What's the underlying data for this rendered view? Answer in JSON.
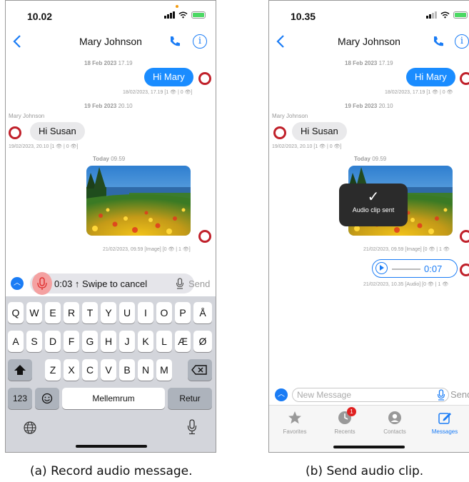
{
  "phone_a": {
    "status": {
      "time": "10.02"
    },
    "nav": {
      "title": "Mary Johnson"
    },
    "messages": {
      "date1": "18 Feb 2023",
      "date1_time": "17.19",
      "out1_text": "Hi Mary",
      "out1_meta": "18/02/2023, 17.19  [1 👁 | 0 👁]",
      "date2": "19 Feb 2023",
      "date2_time": "20.10",
      "in_sender": "Mary Johnson",
      "in1_text": "Hi Susan",
      "in1_meta": "19/02/2023, 20.10  [1 👁 | 0 👁]",
      "today": "Today",
      "today_time": "09.59",
      "img_meta": "21/02/2023, 09.59 [Image]  [0 👁 | 1 👁]"
    },
    "recorder": {
      "text": "0:03 ↑ Swipe to cancel",
      "send": "Send"
    },
    "keyboard": {
      "row1": [
        "Q",
        "W",
        "E",
        "R",
        "T",
        "Y",
        "U",
        "I",
        "O",
        "P",
        "Å"
      ],
      "row2": [
        "A",
        "S",
        "D",
        "F",
        "G",
        "H",
        "J",
        "K",
        "L",
        "Æ",
        "Ø"
      ],
      "row3": [
        "Z",
        "X",
        "C",
        "V",
        "B",
        "N",
        "M"
      ],
      "num_key": "123",
      "space": "Mellemrum",
      "return": "Retur"
    },
    "caption": "(a) Record audio message."
  },
  "phone_b": {
    "status": {
      "time": "10.35"
    },
    "nav": {
      "title": "Mary Johnson"
    },
    "messages": {
      "date1": "18 Feb 2023",
      "date1_time": "17.19",
      "out1_text": "Hi Mary",
      "out1_meta": "18/02/2023, 17.19  [1 👁 | 0 👁",
      "date2": "19 Feb 2023",
      "date2_time": "20.10",
      "in_sender": "Mary Johnson",
      "in1_text": "Hi Susan",
      "in1_meta": "19/02/2023, 20.10  [1 👁 | 0 👁]",
      "today": "Today",
      "today_time": "09.59",
      "img_meta": "21/02/2023, 09.59 [Image]  [0 👁 | 1 👁",
      "audio_duration": "0:07",
      "audio_meta": "21/02/2023, 10.35 [Audio]  [0 👁 | 1 👁"
    },
    "toast": "Audio clip sent",
    "composer": {
      "placeholder": "New Message",
      "send": "Send"
    },
    "tabs": [
      {
        "label": "Favorites",
        "icon": "star-icon"
      },
      {
        "label": "Recents",
        "icon": "clock-icon",
        "badge": "1"
      },
      {
        "label": "Contacts",
        "icon": "person-icon"
      },
      {
        "label": "Messages",
        "icon": "compose-icon"
      }
    ],
    "caption": "(b) Send audio clip."
  },
  "colors": {
    "accent": "#1a7cf5",
    "outgoing_bubble": "#1a8cff",
    "recording": "#f4a1a1",
    "avatar_ring": "#c0202a"
  }
}
